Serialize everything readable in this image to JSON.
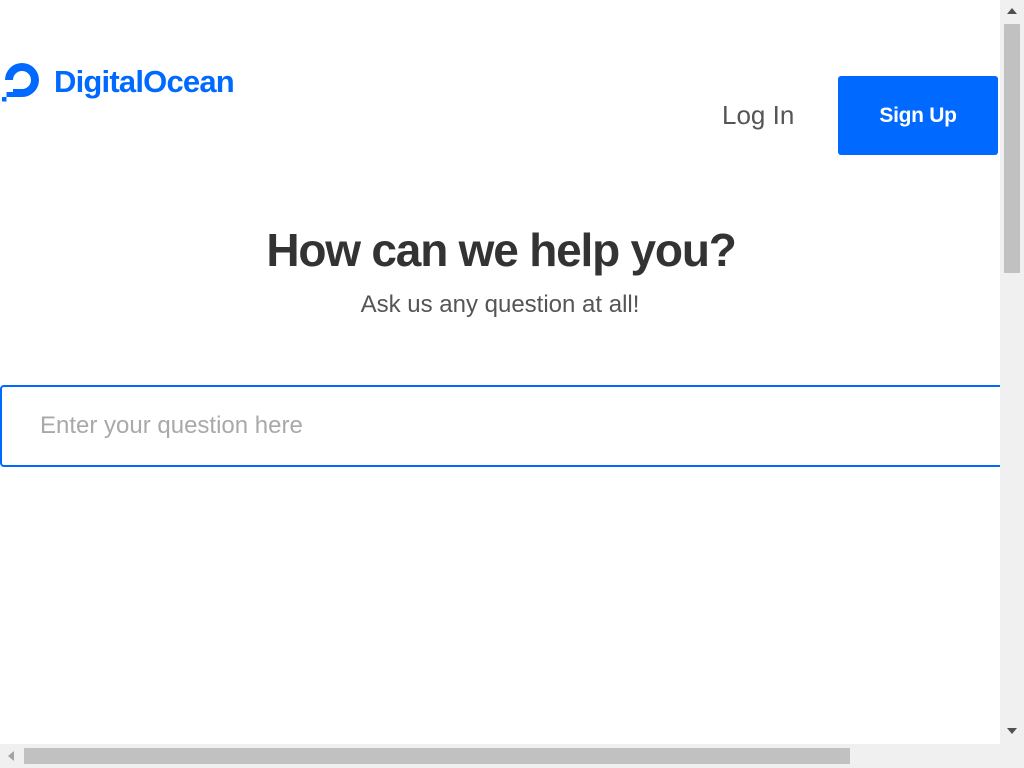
{
  "header": {
    "brand": "DigitalOcean",
    "login_label": "Log In",
    "signup_label": "Sign Up"
  },
  "hero": {
    "title": "How can we help you?",
    "subtitle": "Ask us any question at all!"
  },
  "search": {
    "value": "",
    "placeholder": "Enter your question here"
  },
  "colors": {
    "brand": "#0069ff",
    "heading": "#333333",
    "text": "#555555",
    "placeholder": "#a9a9a9",
    "scrollbar_track": "#f0f0f0",
    "scrollbar_thumb": "#c1c1c1"
  },
  "icons": {
    "logo": "digitalocean-logo-icon"
  }
}
